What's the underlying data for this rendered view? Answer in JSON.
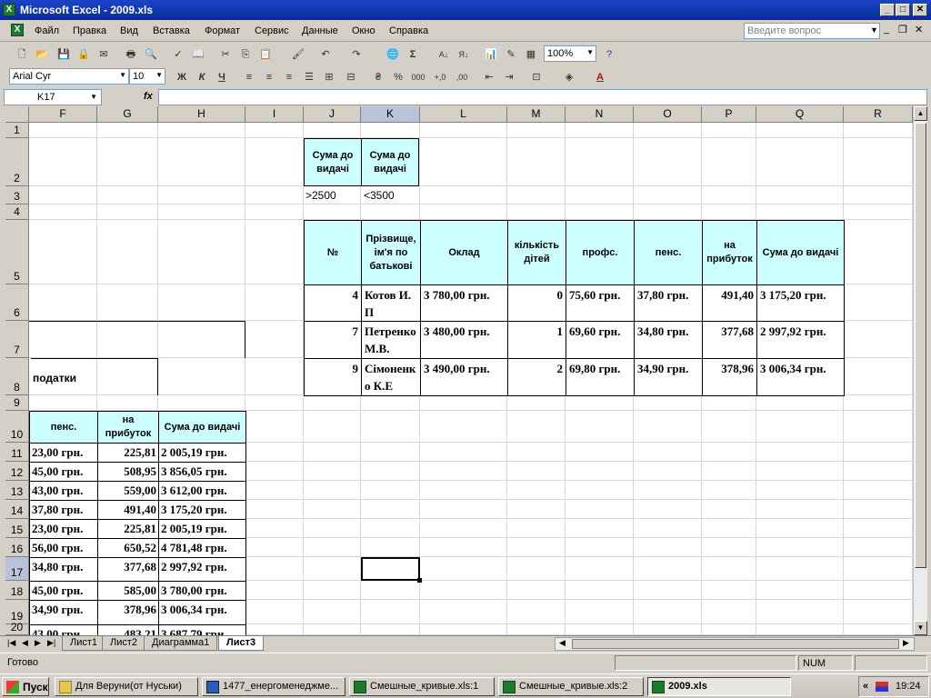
{
  "window": {
    "title": "Microsoft Excel - 2009.xls"
  },
  "menu": {
    "items": [
      "Файл",
      "Правка",
      "Вид",
      "Вставка",
      "Формат",
      "Сервис",
      "Данные",
      "Окно",
      "Справка"
    ],
    "help_placeholder": "Введите вопрос"
  },
  "toolbar": {
    "zoom": "100%",
    "font": "Arial Cyr",
    "size": "10"
  },
  "formula_bar": {
    "name_box": "K17",
    "fx": "fx",
    "content": ""
  },
  "columns": [
    "F",
    "G",
    "H",
    "I",
    "J",
    "K",
    "L",
    "M",
    "N",
    "O",
    "P",
    "Q",
    "R"
  ],
  "rows": [
    "1",
    "2",
    "3",
    "4",
    "5",
    "6",
    "7",
    "8",
    "9",
    "10",
    "11",
    "12",
    "13",
    "14",
    "15",
    "16",
    "17",
    "18",
    "19",
    "20"
  ],
  "criteria": {
    "h1": "Сума до видачі",
    "h2": "Сума до видачі",
    "v1": ">2500",
    "v2": "<3500"
  },
  "result_table": {
    "headers": [
      "№",
      "Прізвище, ім'я по батькові",
      "Оклад",
      "кількість дітей",
      "профс.",
      "пенс.",
      "на прибуток",
      "Сума до видачі"
    ],
    "rows": [
      [
        "4",
        "Котов И.П",
        "3 780,00 грн.",
        "0",
        "75,60 грн.",
        "37,80 грн.",
        "491,40",
        "3 175,20 грн."
      ],
      [
        "7",
        "Петренко М.В.",
        "3 480,00 грн.",
        "1",
        "69,60 грн.",
        "34,80 грн.",
        "377,68",
        "2 997,92 грн."
      ],
      [
        "9",
        "Сімоненко К.Е",
        "3 490,00 грн.",
        "2",
        "69,80 грн.",
        "34,90 грн.",
        "378,96",
        "3 006,34 грн."
      ]
    ]
  },
  "left_table": {
    "group_label": "податки",
    "headers": [
      "пенс.",
      "на прибуток",
      "Сума до видачі"
    ],
    "rows": [
      [
        "23,00 грн.",
        "225,81",
        "2 005,19 грн."
      ],
      [
        "45,00 грн.",
        "508,95",
        "3 856,05 грн."
      ],
      [
        "43,00 грн.",
        "559,00",
        "3 612,00 грн."
      ],
      [
        "37,80 грн.",
        "491,40",
        "3 175,20 грн."
      ],
      [
        "23,00 грн.",
        "225,81",
        "2 005,19 грн."
      ],
      [
        "56,00 грн.",
        "650,52",
        "4 781,48 грн."
      ],
      [
        "34,80 грн.",
        "377,68",
        "2 997,92 грн."
      ],
      [
        "45,00 грн.",
        "585,00",
        "3 780,00 грн."
      ],
      [
        "34,90 грн.",
        "378,96",
        "3 006,34 грн."
      ],
      [
        "43,00 грн.",
        "483,21",
        "3 687,79 грн."
      ]
    ]
  },
  "sheet_tabs": [
    "Лист1",
    "Лист2",
    "Диаграмма1",
    "Лист3"
  ],
  "status": {
    "text": "Готово",
    "num": "NUM"
  },
  "taskbar": {
    "start": "Пуск",
    "tasks": [
      "Для Веруни(от Нуськи)",
      "1477_енергоменеджме...",
      "Смешные_кривые.xls:1",
      "Смешные_кривые.xls:2",
      "2009.xls"
    ],
    "lang": "«",
    "clock": "19:24"
  }
}
